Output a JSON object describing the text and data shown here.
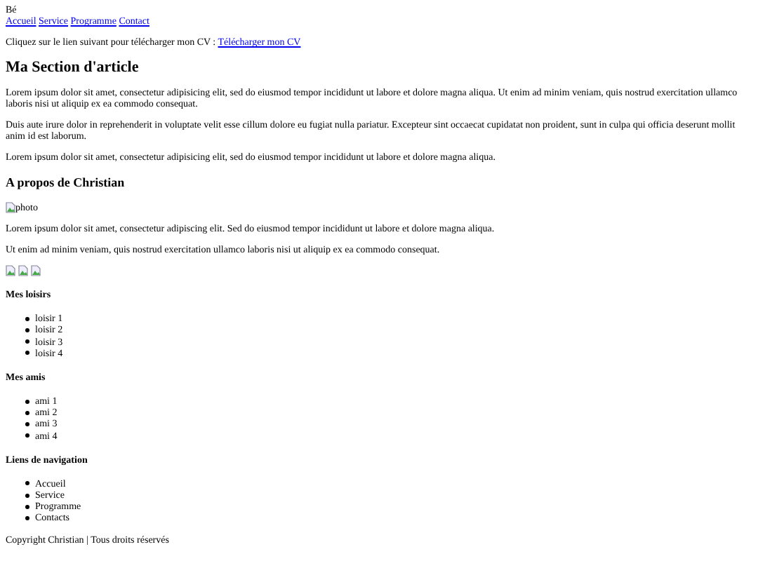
{
  "header_text": "Bé",
  "nav_links": [
    "Accueil",
    "Service",
    "Programme",
    "Contact"
  ],
  "cv_line": {
    "text": "Cliquez sur le lien suivant pour télécharger mon CV :",
    "link": "Télécharger mon CV"
  },
  "article": {
    "title": "Ma Section d'article",
    "paragraphs": [
      "Lorem ipsum dolor sit amet, consectetur adipisicing elit, sed do eiusmod tempor incididunt ut labore et dolore magna aliqua. Ut enim ad minim veniam, quis nostrud exercitation ullamco laboris nisi ut aliquip ex ea commodo consequat.",
      "Duis aute irure dolor in reprehenderit in voluptate velit esse cillum dolore eu fugiat nulla pariatur. Excepteur sint occaecat cupidatat non proident, sunt in culpa qui officia deserunt mollit anim id est laborum.",
      "Lorem ipsum dolor sit amet, consectetur adipisicing elit, sed do eiusmod tempor incididunt ut labore et dolore magna aliqua."
    ]
  },
  "about": {
    "title": "A propos de Christian",
    "photo_alt": "photo",
    "paragraphs": [
      "Lorem ipsum dolor sit amet, consectetur adipiscing elit. Sed do eiusmod tempor incididunt ut labore et dolore magna aliqua.",
      "Ut enim ad minim veniam, quis nostrud exercitation ullamco laboris nisi ut aliquip ex ea commodo consequat."
    ],
    "images": [
      {
        "kind": "broken_image"
      },
      {
        "kind": "broken_image"
      },
      {
        "kind": "broken_image"
      }
    ]
  },
  "lists": [
    {
      "title": "Mes loisirs",
      "items": [
        "loisir 1",
        "loisir 2",
        "loisir 3",
        "loisir 4"
      ]
    },
    {
      "title": "Mes amis",
      "items": [
        "ami 1",
        "ami 2",
        "ami 3",
        "ami 4"
      ]
    },
    {
      "title": "Liens de navigation",
      "items": [
        "Accueil",
        "Service",
        "Programme",
        "Contacts"
      ]
    }
  ],
  "footer": "Copyright Christian | Tous droits réservés"
}
